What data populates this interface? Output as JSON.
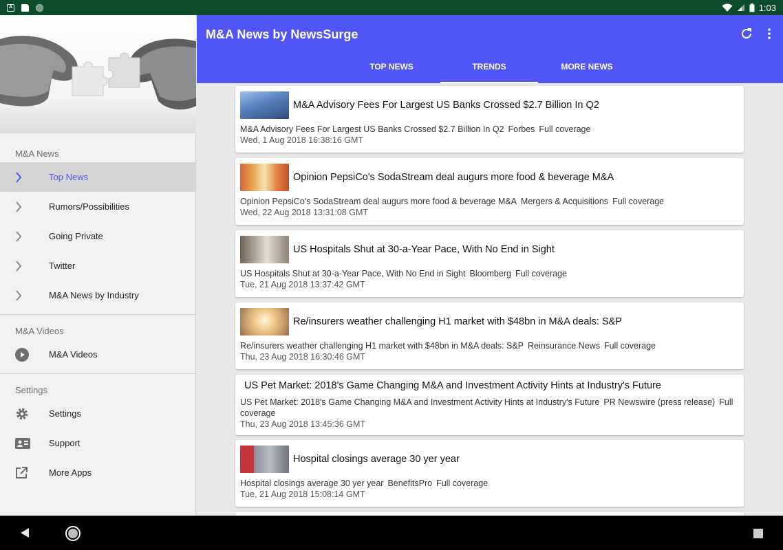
{
  "status_bar": {
    "time": "1:03",
    "left_icons": [
      "a-notification-icon",
      "sd-card-icon",
      "circle-app-icon"
    ]
  },
  "app": {
    "title": "M&A News by NewsSurge"
  },
  "tabs": [
    {
      "label": "TOP NEWS",
      "selected": false
    },
    {
      "label": "TRENDS",
      "selected": true
    },
    {
      "label": "MORE NEWS",
      "selected": false
    }
  ],
  "drawer": {
    "sections": [
      {
        "title": "M&A News",
        "items": [
          {
            "label": "Top News",
            "icon": "chevron-right-icon",
            "active": true
          },
          {
            "label": "Rumors/Possibilities",
            "icon": "chevron-right-icon",
            "active": false
          },
          {
            "label": "Going Private",
            "icon": "chevron-right-icon",
            "active": false
          },
          {
            "label": "Twitter",
            "icon": "chevron-right-icon",
            "active": false
          },
          {
            "label": "M&A News by Industry",
            "icon": "chevron-right-icon",
            "active": false
          }
        ]
      },
      {
        "title": "M&A Videos",
        "items": [
          {
            "label": "M&A Videos",
            "icon": "play-circle-icon",
            "active": false
          }
        ]
      },
      {
        "title": "Settings",
        "items": [
          {
            "label": "Settings",
            "icon": "gear-icon",
            "active": false
          },
          {
            "label": "Support",
            "icon": "contact-card-icon",
            "active": false
          },
          {
            "label": "More Apps",
            "icon": "open-external-icon",
            "active": false
          }
        ]
      }
    ]
  },
  "articles": [
    {
      "headline": "M&A Advisory Fees For Largest US Banks Crossed $2.7 Billion In Q2",
      "summary": "M&A Advisory Fees For Largest US Banks Crossed $2.7 Billion In Q2",
      "source": "Forbes",
      "coverage": "Full coverage",
      "date": "Wed, 1 Aug 2018 16:38:16 GMT",
      "thumb": "skyscraper"
    },
    {
      "headline": "Opinion PepsiCo's SodaStream deal augurs more food & beverage M&A",
      "summary": "Opinion PepsiCo's SodaStream deal augurs more food & beverage M&A",
      "source": "Mergers & Acquisitions",
      "coverage": "Full coverage",
      "date": "Wed, 22 Aug 2018 13:31:08 GMT",
      "thumb": "supermarket"
    },
    {
      "headline": "US Hospitals Shut at 30-a-Year Pace, With No End in Sight",
      "summary": "US Hospitals Shut at 30-a-Year Pace, With No End in Sight",
      "source": "Bloomberg",
      "coverage": "Full coverage",
      "date": "Tue, 21 Aug 2018 13:37:42 GMT",
      "thumb": "hospital-room"
    },
    {
      "headline": "Re/insurers weather challenging H1 market with $48bn in M&A deals: S&P",
      "summary": "Re/insurers weather challenging H1 market with $48bn in M&A deals: S&P",
      "source": "Reinsurance News",
      "coverage": "Full coverage",
      "date": "Thu, 23 Aug 2018 16:30:46 GMT",
      "thumb": "people-sunset"
    },
    {
      "headline": "US Pet Market: 2018's Game Changing M&A and Investment Activity Hints at Industry's Future",
      "summary": "US Pet Market: 2018's Game Changing M&A and Investment Activity Hints at Industry's Future",
      "source": "PR Newswire (press release)",
      "coverage": "Full coverage",
      "date": "Thu, 23 Aug 2018 13:45:36 GMT",
      "thumb": ""
    },
    {
      "headline": "Hospital closings average 30 yer year",
      "summary": "Hospital closings average 30 yer year",
      "source": "BenefitsPro",
      "coverage": "Full coverage",
      "date": "Tue, 21 Aug 2018 15:08:14 GMT",
      "thumb": "hospital-exterior"
    }
  ]
}
